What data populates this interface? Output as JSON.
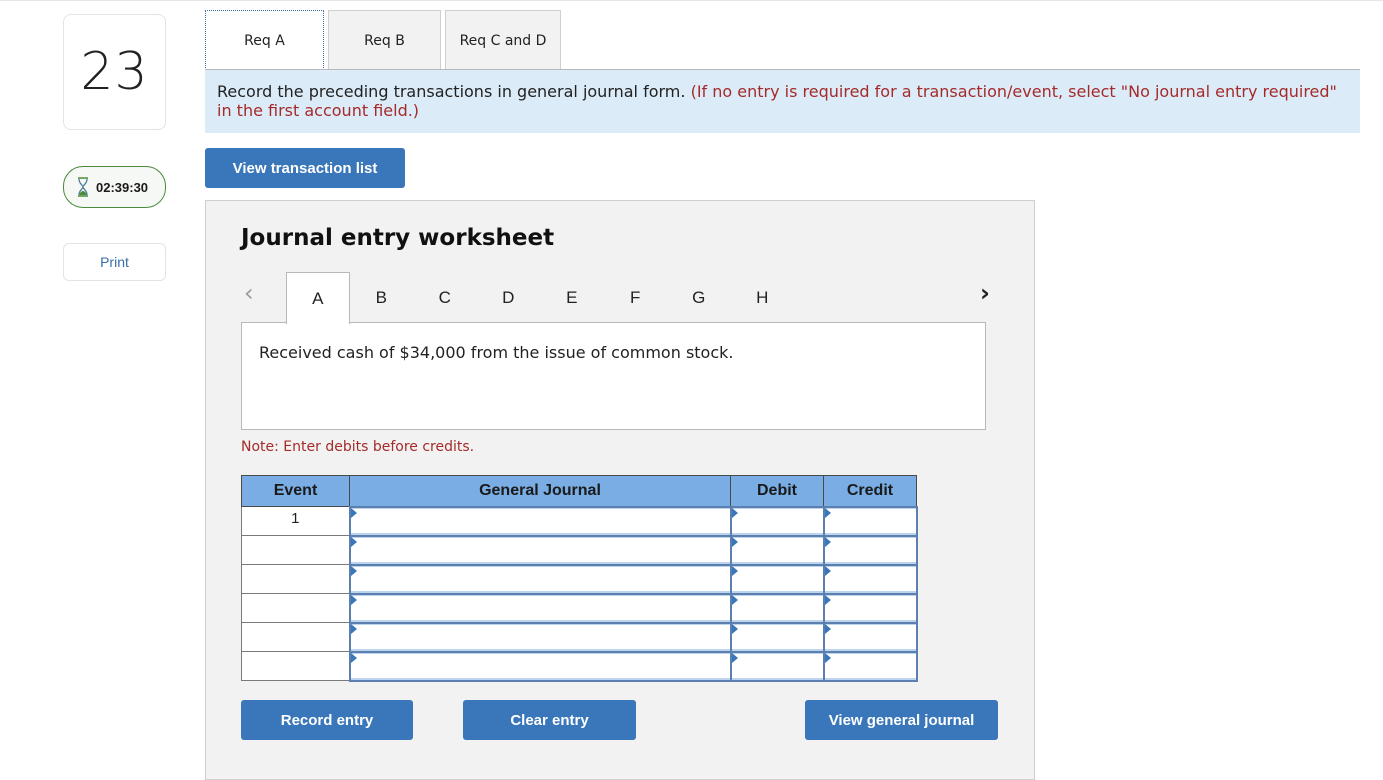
{
  "question": {
    "number": "23",
    "timer": "02:39:30",
    "print_label": "Print"
  },
  "req_tabs": [
    {
      "label": "Req A",
      "active": true
    },
    {
      "label": "Req B",
      "active": false
    },
    {
      "label": "Req C and D",
      "active": false
    }
  ],
  "instructions": {
    "main": "Record the preceding transactions in general journal form.",
    "note": "(If no entry is required for a transaction/event, select \"No journal entry required\" in the first account field.)"
  },
  "view_transaction_list_label": "View transaction list",
  "worksheet": {
    "title": "Journal entry worksheet",
    "prev_icon": "‹",
    "next_icon": "›",
    "tabs": [
      "A",
      "B",
      "C",
      "D",
      "E",
      "F",
      "G",
      "H"
    ],
    "active_tab": "A",
    "transaction_text": "Received cash of $34,000 from the issue of common stock.",
    "note": "Note: Enter debits before credits.",
    "table": {
      "headers": [
        "Event",
        "General Journal",
        "Debit",
        "Credit"
      ],
      "rows": [
        {
          "event": "1",
          "account": "",
          "debit": "",
          "credit": ""
        },
        {
          "event": "",
          "account": "",
          "debit": "",
          "credit": ""
        },
        {
          "event": "",
          "account": "",
          "debit": "",
          "credit": ""
        },
        {
          "event": "",
          "account": "",
          "debit": "",
          "credit": ""
        },
        {
          "event": "",
          "account": "",
          "debit": "",
          "credit": ""
        },
        {
          "event": "",
          "account": "",
          "debit": "",
          "credit": ""
        }
      ]
    },
    "buttons": {
      "record": "Record entry",
      "clear": "Clear entry",
      "view_general_journal": "View general journal"
    }
  },
  "colors": {
    "primary_button": "#3a77ba",
    "instruction_bg": "#dbecf8",
    "table_header": "#79ade3",
    "note_red": "#a52a2a",
    "timer_border": "#4a8a3a"
  }
}
